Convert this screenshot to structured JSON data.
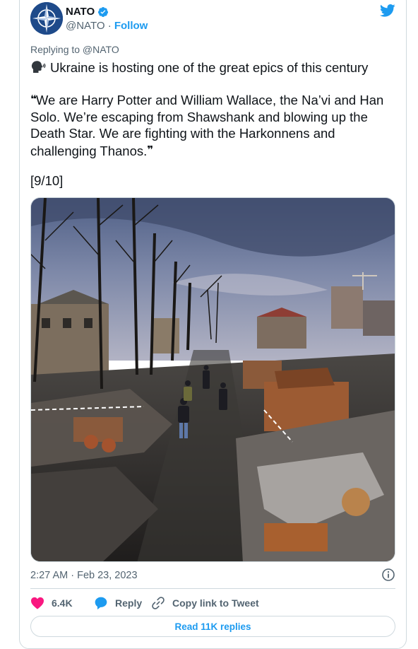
{
  "colors": {
    "accent": "#1d9bf0",
    "text": "#0f1419",
    "muted": "#536471",
    "like": "#f91880",
    "border": "#cfd9de"
  },
  "author": {
    "name": "NATO",
    "handle": "@NATO",
    "separator": "·",
    "follow_label": "Follow",
    "avatar_icon": "nato-compass-star-icon",
    "verified_icon": "verified-badge-icon"
  },
  "platform_icon": "twitter-bird-icon",
  "tweet": {
    "replying_to": "Replying to @NATO",
    "line1_icon": "speaking-head-icon",
    "line1": "Ukraine is hosting one of the great epics of this century",
    "quote_open": "❝",
    "quote_text": "We are Harry Potter and William Wallace, the Na’vi and Han Solo. We’re escaping from Shawshank and blowing up the Death Star. We are fighting with the Harkonnens and challenging Thanos.",
    "quote_close": "❞",
    "thread_count": "[9/10]",
    "photo_icon": "war-destroyed-street-photo"
  },
  "meta": {
    "timestamp": "2:27 AM · Feb 23, 2023",
    "info_icon": "info-circle-icon"
  },
  "actions": {
    "likes": "6.4K",
    "like_icon": "heart-icon",
    "reply_label": "Reply",
    "reply_icon": "reply-bubble-icon",
    "copy_label": "Copy link to Tweet",
    "copy_icon": "link-icon"
  },
  "read_replies_label": "Read 11K replies"
}
